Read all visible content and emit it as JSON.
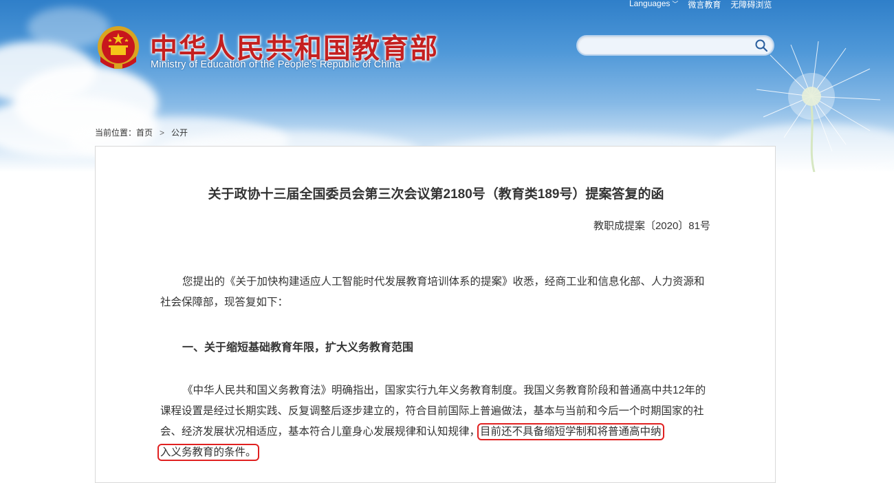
{
  "header": {
    "top_links": {
      "languages": "Languages",
      "weibo": "微言教育",
      "accessibility": "无障碍浏览"
    },
    "site_title": "中华人民共和国教育部",
    "site_subtitle": "Ministry of Education of the People's Republic of China",
    "search": {
      "value": "",
      "placeholder": ""
    }
  },
  "breadcrumb": {
    "prefix": "当前位置：",
    "items": [
      "首页",
      "公开"
    ],
    "separator": ">"
  },
  "article": {
    "title": "关于政协十三届全国委员会第三次会议第2180号（教育类189号）提案答复的函",
    "doc_number": "教职成提案〔2020〕81号",
    "para1": "您提出的《关于加快构建适应人工智能时代发展教育培训体系的提案》收悉，经商工业和信息化部、人力资源和社会保障部，现答复如下：",
    "heading1": "一、关于缩短基础教育年限，扩大义务教育范围",
    "para2_normal": "《中华人民共和国义务教育法》明确指出，国家实行九年义务教育制度。我国义务教育阶段和普通高中共12年的课程设置是经过长期实践、反复调整后逐步建立的，符合目前国际上普遍做法，基本与当前和今后一个时期国家的社会、经济发展状况相适应，基本符合儿童身心发展规律和认知规律，",
    "para2_highlight1": "目前还不具备缩短学制和将普通高中纳",
    "para2_highlight2": "入义务教育的条件。"
  },
  "colors": {
    "title_red": "#c42020",
    "highlight_border": "#e02020",
    "text": "#333333"
  }
}
